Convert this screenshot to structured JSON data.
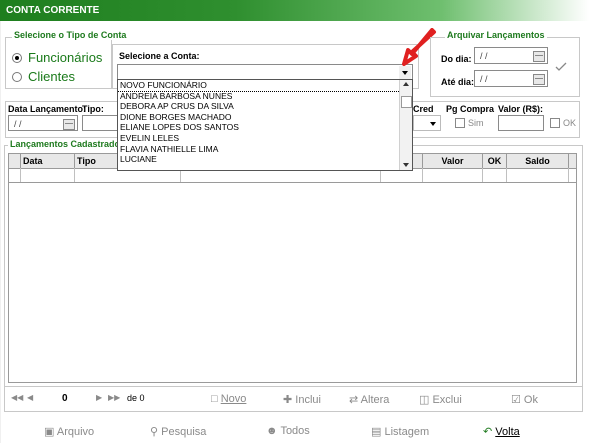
{
  "window": {
    "title": "CONTA CORRENTE"
  },
  "tipo_conta": {
    "legend": "Selecione o Tipo de Conta",
    "options": [
      {
        "label": "Funcionários",
        "selected": true
      },
      {
        "label": "Clientes",
        "selected": false
      }
    ]
  },
  "conta": {
    "label": "Selecione a Conta:",
    "value": "",
    "options": [
      "NOVO FUNCIONÁRIO",
      "ANDREIA BARBOSA NUNES",
      "DEBORA AP CRUS DA SILVA",
      "DIONE BORGES MACHADO",
      "ELIANE LOPES DOS SANTOS",
      "EVELIN LELES",
      "FLAVIA NATHIELLE LIMA",
      "LUCIANE"
    ],
    "highlighted": "NOVO FUNCIONÁRIO"
  },
  "arquivar": {
    "legend": "Arquivar Lançamentos",
    "do_dia_label": "Do dia:",
    "do_dia_value": "/ /",
    "ate_dia_label": "Até dia:",
    "ate_dia_value": "/ /"
  },
  "lancamento": {
    "data_label": "Data Lançamento:",
    "data_value": "/ /",
    "tipo_label": "Tipo:",
    "cred_label": "Cred",
    "pg_compra_label": "Pg Compra",
    "sim_label": "Sim",
    "valor_label": "Valor (R$):",
    "ok_label": "OK"
  },
  "cadastrados": {
    "legend": "Lançamentos Cadastrados",
    "columns": [
      "Data",
      "Tipo",
      "Valor",
      "OK",
      "Saldo"
    ]
  },
  "navigator": {
    "position": "0",
    "total": "de 0",
    "buttons": [
      "Novo",
      "Inclui",
      "Altera",
      "Exclui",
      "Ok"
    ]
  },
  "footer": [
    "Arquivo",
    "Pesquisa",
    "Todos",
    "Listagem",
    "Volta"
  ],
  "colors": {
    "accent": "#1e7a1e",
    "arrow": "#e02020",
    "disabled": "#8a8a8a"
  }
}
